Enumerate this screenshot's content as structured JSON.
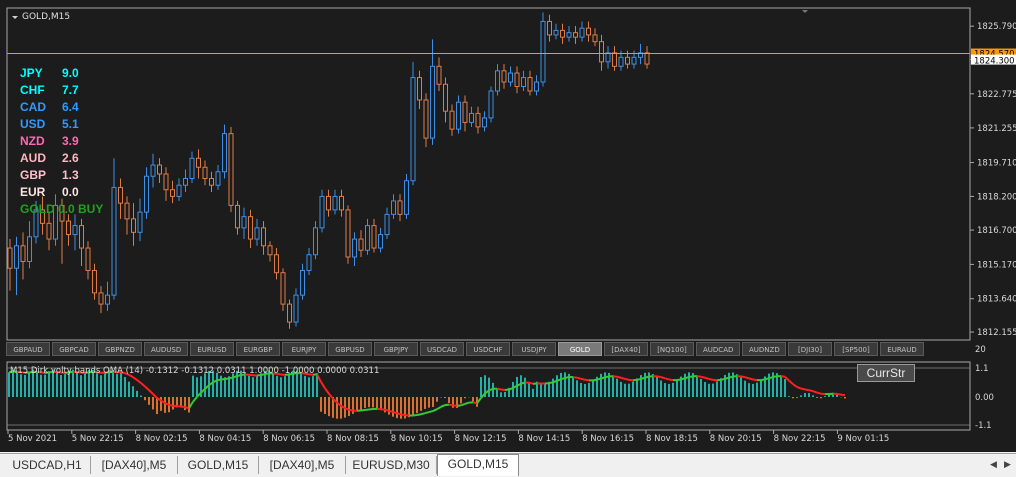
{
  "chart": {
    "title": "GOLD,M15",
    "bid_price": "1824.570",
    "ask_price": "1824.300",
    "price_levels": [
      "1825.790",
      "1824.300",
      "1822.775",
      "1821.255",
      "1819.710",
      "1818.200",
      "1816.700",
      "1815.170",
      "1813.640",
      "1812.155"
    ],
    "time_labels": [
      "5 Nov 2021",
      "5 Nov 22:15",
      "8 Nov 02:15",
      "8 Nov 04:15",
      "8 Nov 06:15",
      "8 Nov 08:15",
      "8 Nov 10:15",
      "8 Nov 12:15",
      "8 Nov 14:15",
      "8 Nov 16:15",
      "8 Nov 18:15",
      "8 Nov 20:15",
      "8 Nov 22:15",
      "9 Nov 01:15"
    ],
    "candles": [
      [
        1815.9,
        1815.0,
        1816.3,
        1814.0
      ],
      [
        1815.0,
        1816.0,
        1816.4,
        1813.8
      ],
      [
        1816.0,
        1815.3,
        1816.6,
        1814.5
      ],
      [
        1815.3,
        1816.4,
        1817.1,
        1815.0
      ],
      [
        1816.4,
        1817.6,
        1818.0,
        1816.1
      ],
      [
        1817.6,
        1817.0,
        1818.2,
        1816.5
      ],
      [
        1817.0,
        1816.3,
        1817.5,
        1815.8
      ],
      [
        1816.3,
        1817.8,
        1818.3,
        1816.0
      ],
      [
        1817.8,
        1817.1,
        1818.1,
        1815.2
      ],
      [
        1817.1,
        1816.5,
        1817.4,
        1816.0
      ],
      [
        1816.5,
        1816.9,
        1817.4,
        1815.8
      ],
      [
        1816.9,
        1815.9,
        1817.2,
        1815.1
      ],
      [
        1815.9,
        1814.9,
        1816.2,
        1814.5
      ],
      [
        1814.9,
        1813.9,
        1815.2,
        1813.6
      ],
      [
        1813.9,
        1813.4,
        1814.2,
        1813.0
      ],
      [
        1813.4,
        1813.8,
        1814.4,
        1813.1
      ],
      [
        1813.8,
        1818.6,
        1819.9,
        1813.6
      ],
      [
        1818.6,
        1817.9,
        1819.0,
        1817.2
      ],
      [
        1817.9,
        1817.2,
        1818.2,
        1816.5
      ],
      [
        1817.2,
        1816.6,
        1817.9,
        1816.0
      ],
      [
        1816.6,
        1817.5,
        1818.1,
        1816.2
      ],
      [
        1817.5,
        1819.1,
        1819.5,
        1817.2
      ],
      [
        1819.1,
        1819.6,
        1820.1,
        1818.6
      ],
      [
        1819.6,
        1819.2,
        1819.9,
        1818.8
      ],
      [
        1819.2,
        1818.5,
        1819.5,
        1818.0
      ],
      [
        1818.5,
        1818.2,
        1818.9,
        1817.9
      ],
      [
        1818.2,
        1818.7,
        1819.0,
        1818.0
      ],
      [
        1818.7,
        1819.0,
        1819.4,
        1818.4
      ],
      [
        1819.0,
        1819.9,
        1820.2,
        1818.8
      ],
      [
        1819.9,
        1819.5,
        1820.3,
        1819.0
      ],
      [
        1819.5,
        1819.0,
        1819.8,
        1818.7
      ],
      [
        1819.0,
        1818.7,
        1819.3,
        1818.4
      ],
      [
        1818.7,
        1819.3,
        1819.6,
        1818.5
      ],
      [
        1819.3,
        1821.0,
        1821.4,
        1819.0
      ],
      [
        1821.0,
        1817.8,
        1821.3,
        1817.5
      ],
      [
        1817.8,
        1816.8,
        1818.0,
        1816.5
      ],
      [
        1816.8,
        1817.3,
        1817.7,
        1816.3
      ],
      [
        1817.3,
        1816.3,
        1817.6,
        1815.9
      ],
      [
        1816.3,
        1816.8,
        1817.2,
        1816.0
      ],
      [
        1816.8,
        1816.0,
        1817.1,
        1815.6
      ],
      [
        1816.0,
        1815.6,
        1816.2,
        1815.3
      ],
      [
        1815.6,
        1814.8,
        1815.9,
        1814.5
      ],
      [
        1814.8,
        1813.4,
        1815.0,
        1813.1
      ],
      [
        1813.4,
        1812.6,
        1813.6,
        1812.3
      ],
      [
        1812.6,
        1813.8,
        1814.1,
        1812.4
      ],
      [
        1813.8,
        1814.9,
        1815.2,
        1813.6
      ],
      [
        1814.9,
        1815.6,
        1815.9,
        1814.7
      ],
      [
        1815.6,
        1816.8,
        1817.1,
        1815.4
      ],
      [
        1816.8,
        1818.2,
        1818.5,
        1816.6
      ],
      [
        1818.2,
        1817.6,
        1818.5,
        1817.3
      ],
      [
        1817.6,
        1818.2,
        1818.5,
        1817.4
      ],
      [
        1818.2,
        1817.6,
        1818.5,
        1817.3
      ],
      [
        1817.6,
        1815.5,
        1817.8,
        1815.2
      ],
      [
        1815.5,
        1816.3,
        1816.6,
        1815.1
      ],
      [
        1816.3,
        1815.8,
        1816.7,
        1815.5
      ],
      [
        1815.8,
        1816.9,
        1817.2,
        1815.6
      ],
      [
        1816.9,
        1815.9,
        1817.2,
        1815.7
      ],
      [
        1815.9,
        1816.5,
        1816.8,
        1815.7
      ],
      [
        1816.5,
        1817.4,
        1817.7,
        1816.3
      ],
      [
        1817.4,
        1818.0,
        1818.3,
        1817.2
      ],
      [
        1818.0,
        1817.4,
        1818.3,
        1817.1
      ],
      [
        1817.4,
        1818.9,
        1819.2,
        1817.2
      ],
      [
        1818.9,
        1823.5,
        1824.2,
        1818.7
      ],
      [
        1823.5,
        1822.5,
        1823.8,
        1822.1
      ],
      [
        1822.5,
        1820.8,
        1822.8,
        1820.4
      ],
      [
        1820.8,
        1824.0,
        1825.2,
        1820.5
      ],
      [
        1824.0,
        1823.2,
        1824.4,
        1822.9
      ],
      [
        1823.2,
        1822.0,
        1823.5,
        1821.5
      ],
      [
        1822.0,
        1821.2,
        1822.3,
        1820.9
      ],
      [
        1821.2,
        1822.4,
        1822.7,
        1821.0
      ],
      [
        1822.4,
        1821.5,
        1822.7,
        1821.1
      ],
      [
        1821.5,
        1821.9,
        1822.2,
        1821.3
      ],
      [
        1821.9,
        1821.3,
        1822.2,
        1821.0
      ],
      [
        1821.3,
        1821.7,
        1822.0,
        1821.1
      ],
      [
        1821.7,
        1822.9,
        1823.1,
        1821.5
      ],
      [
        1822.9,
        1823.8,
        1824.1,
        1822.7
      ],
      [
        1823.8,
        1823.3,
        1824.1,
        1823.0
      ],
      [
        1823.3,
        1823.7,
        1824.0,
        1823.1
      ],
      [
        1823.7,
        1823.1,
        1824.0,
        1822.8
      ],
      [
        1823.1,
        1823.5,
        1823.8,
        1822.9
      ],
      [
        1823.5,
        1822.9,
        1823.8,
        1822.7
      ],
      [
        1822.9,
        1823.3,
        1823.6,
        1822.7
      ],
      [
        1823.3,
        1826.0,
        1826.4,
        1823.1
      ],
      [
        1826.0,
        1825.4,
        1826.3,
        1825.1
      ],
      [
        1825.4,
        1825.6,
        1825.9,
        1825.2
      ],
      [
        1825.6,
        1825.3,
        1825.9,
        1825.0
      ],
      [
        1825.3,
        1825.5,
        1825.8,
        1825.1
      ],
      [
        1825.5,
        1825.3,
        1825.8,
        1825.0
      ],
      [
        1825.3,
        1825.7,
        1826.0,
        1825.1
      ],
      [
        1825.7,
        1825.4,
        1826.0,
        1825.1
      ],
      [
        1825.4,
        1825.1,
        1825.7,
        1824.9
      ],
      [
        1825.1,
        1824.2,
        1825.4,
        1823.8
      ],
      [
        1824.2,
        1824.6,
        1824.9,
        1823.9
      ],
      [
        1824.6,
        1824.0,
        1824.9,
        1823.8
      ],
      [
        1824.0,
        1824.4,
        1824.7,
        1823.8
      ],
      [
        1824.4,
        1824.1,
        1824.7,
        1823.9
      ],
      [
        1824.1,
        1824.4,
        1824.7,
        1823.9
      ],
      [
        1824.4,
        1824.6,
        1825.0,
        1824.1
      ],
      [
        1824.6,
        1824.1,
        1824.9,
        1823.9
      ]
    ]
  },
  "currency_strength": [
    {
      "currency": "JPY",
      "value": "9.0",
      "color": "#00ffff"
    },
    {
      "currency": "CHF",
      "value": "7.7",
      "color": "#00ffff"
    },
    {
      "currency": "CAD",
      "value": "6.4",
      "color": "#3399ff"
    },
    {
      "currency": "USD",
      "value": "5.1",
      "color": "#3399ff"
    },
    {
      "currency": "NZD",
      "value": "3.9",
      "color": "#ff69b4"
    },
    {
      "currency": "AUD",
      "value": "2.6",
      "color": "#ffb6c1"
    },
    {
      "currency": "GBP",
      "value": "1.3",
      "color": "#ffc0cb"
    },
    {
      "currency": "EUR",
      "value": "0.0",
      "color": "#ffe4e1"
    }
  ],
  "gold_label": "GOLD 0.0 BUY",
  "symbol_buttons": [
    "GBPAUD",
    "GBPCAD",
    "GBPNZD",
    "AUDUSD",
    "EURUSD",
    "EURGBP",
    "EURJPY",
    "GBPUSD",
    "GBPJPY",
    "USDCAD",
    "USDCHF",
    "USDJPY",
    "GOLD",
    "[DAX40]",
    "[NQ100]",
    "AUDCAD",
    "AUDNZD",
    "[DJI30]",
    "[SP500]",
    "EURAUD"
  ],
  "active_symbol": "GOLD",
  "indicator": {
    "label": "M15 Dirk volty bands OMA (14) -0.1312 -0.1312 0.0311 1.0000 -1.0000 0.0000 0.0311",
    "levels": [
      "1.1",
      "0.00",
      "-1.1"
    ],
    "sub_top_label": "20",
    "button_label": "CurrStr"
  },
  "tabs": [
    "USDCAD,H1",
    "[DAX40],M5",
    "GOLD,M15",
    "[DAX40],M5",
    "EURUSD,M30",
    "GOLD,M15"
  ],
  "active_tab": 5,
  "colors": {
    "bull": "#3d8fe8",
    "bear": "#e07b45",
    "price_line": "#ff9900",
    "osc_green": "#33cc33",
    "osc_red": "#ff2020",
    "hist_up": "#24b0a8",
    "hist_down": "#d8722e"
  }
}
